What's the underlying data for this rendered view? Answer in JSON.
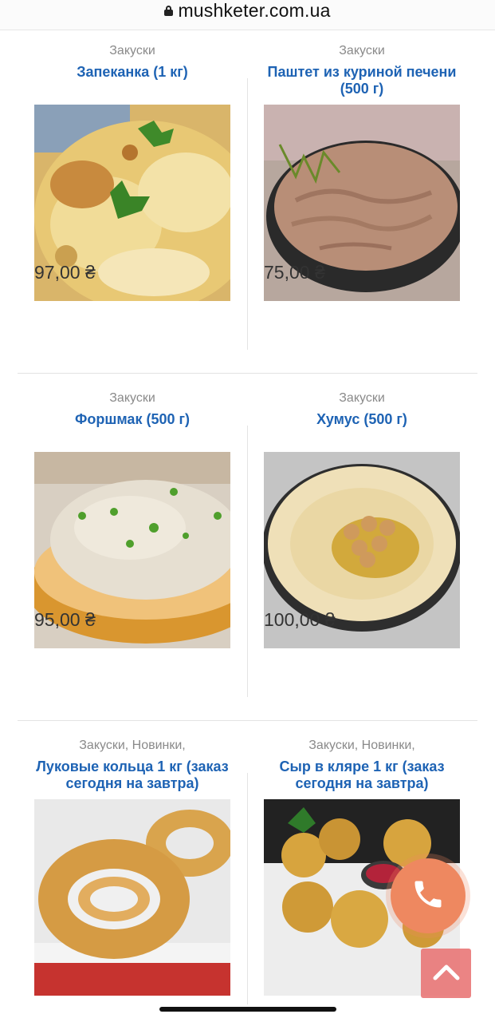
{
  "browser": {
    "url": "mushketer.com.ua"
  },
  "products": [
    {
      "category": "Закуски",
      "title": "Запеканка (1 кг)",
      "price": "97,00 ₴",
      "image": "casserole"
    },
    {
      "category": "Закуски",
      "title": "Паштет из куриной печени (500 г)",
      "price": "75,00 ₴",
      "image": "liver-pate"
    },
    {
      "category": "Закуски",
      "title": "Форшмак (500 г)",
      "price": "95,00 ₴",
      "image": "forshmak"
    },
    {
      "category": "Закуски",
      "title": "Хумус (500 г)",
      "price": "100,00 ₴",
      "image": "hummus"
    },
    {
      "category": "Закуски, Новинки,",
      "title": "Луковые кольца 1 кг (заказ сегодня на завтра)",
      "price": "",
      "image": "onion-rings"
    },
    {
      "category": "Закуски, Новинки,",
      "title": "Сыр в кляре 1 кг (заказ сегодня на завтра)",
      "price": "",
      "image": "cheese-in-batter"
    }
  ],
  "actions": {
    "call": "phone-icon",
    "scroll_top": "chevron-up-icon"
  },
  "colors": {
    "title": "#1e63b4",
    "call_button": "#ee8860",
    "up_button": "#e86e6e"
  }
}
